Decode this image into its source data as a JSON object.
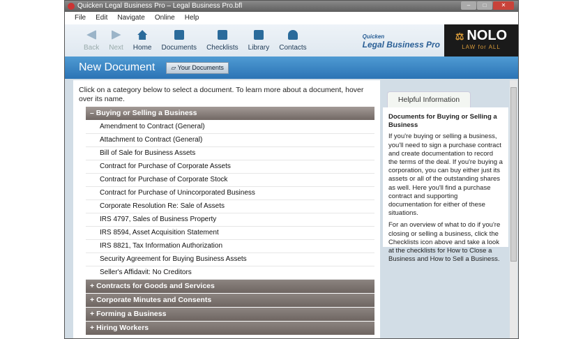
{
  "window": {
    "title": "Quicken Legal Business Pro – Legal Business Pro.bfl"
  },
  "menu": [
    "File",
    "Edit",
    "Navigate",
    "Online",
    "Help"
  ],
  "toolbar": [
    {
      "label": "Back",
      "disabled": true
    },
    {
      "label": "Next",
      "disabled": true
    },
    {
      "label": "Home"
    },
    {
      "label": "Documents"
    },
    {
      "label": "Checklists"
    },
    {
      "label": "Library"
    },
    {
      "label": "Contacts"
    }
  ],
  "brand": {
    "top": "Quicken",
    "name": "Legal Business Pro",
    "nolo": "NOLO",
    "tagline": "LAW for ALL"
  },
  "page": {
    "title": "New Document",
    "your_documents": "Your Documents",
    "intro": "Click on a category below to select a document. To learn more about a document, hover over its name."
  },
  "open_category": {
    "label": "Buying or Selling a Business",
    "items": [
      "Amendment to Contract (General)",
      "Attachment to Contract (General)",
      "Bill of Sale for Business Assets",
      "Contract for Purchase of Corporate Assets",
      "Contract for Purchase of Corporate Stock",
      "Contract for Purchase of Unincorporated Business",
      "Corporate Resolution Re: Sale of Assets",
      "IRS 4797, Sales of Business Property",
      "IRS 8594, Asset Acquisition Statement",
      "IRS 8821, Tax Information Authorization",
      "Security Agreement for Buying Business Assets",
      "Seller's Affidavit: No Creditors"
    ]
  },
  "categories": [
    "Contracts for Goods and Services",
    "Corporate Minutes and Consents",
    "Forming a Business",
    "Hiring Workers"
  ],
  "help": {
    "tab": "Helpful Information",
    "heading": "Documents for Buying or Selling a Business",
    "p1": "If you're buying or selling a business, you'll need to sign a purchase contract and create documentation to record the terms of the deal. If you're buying a corporation, you can buy either just its assets or all of the outstanding shares as well. Here you'll find a purchase contract and supporting documentation for either of these situations.",
    "p2": "For an overview of what to do if you're closing or selling a business, click the Checklists icon above and take a look at the checklists for How to Close a Business and How to Sell a Business."
  }
}
